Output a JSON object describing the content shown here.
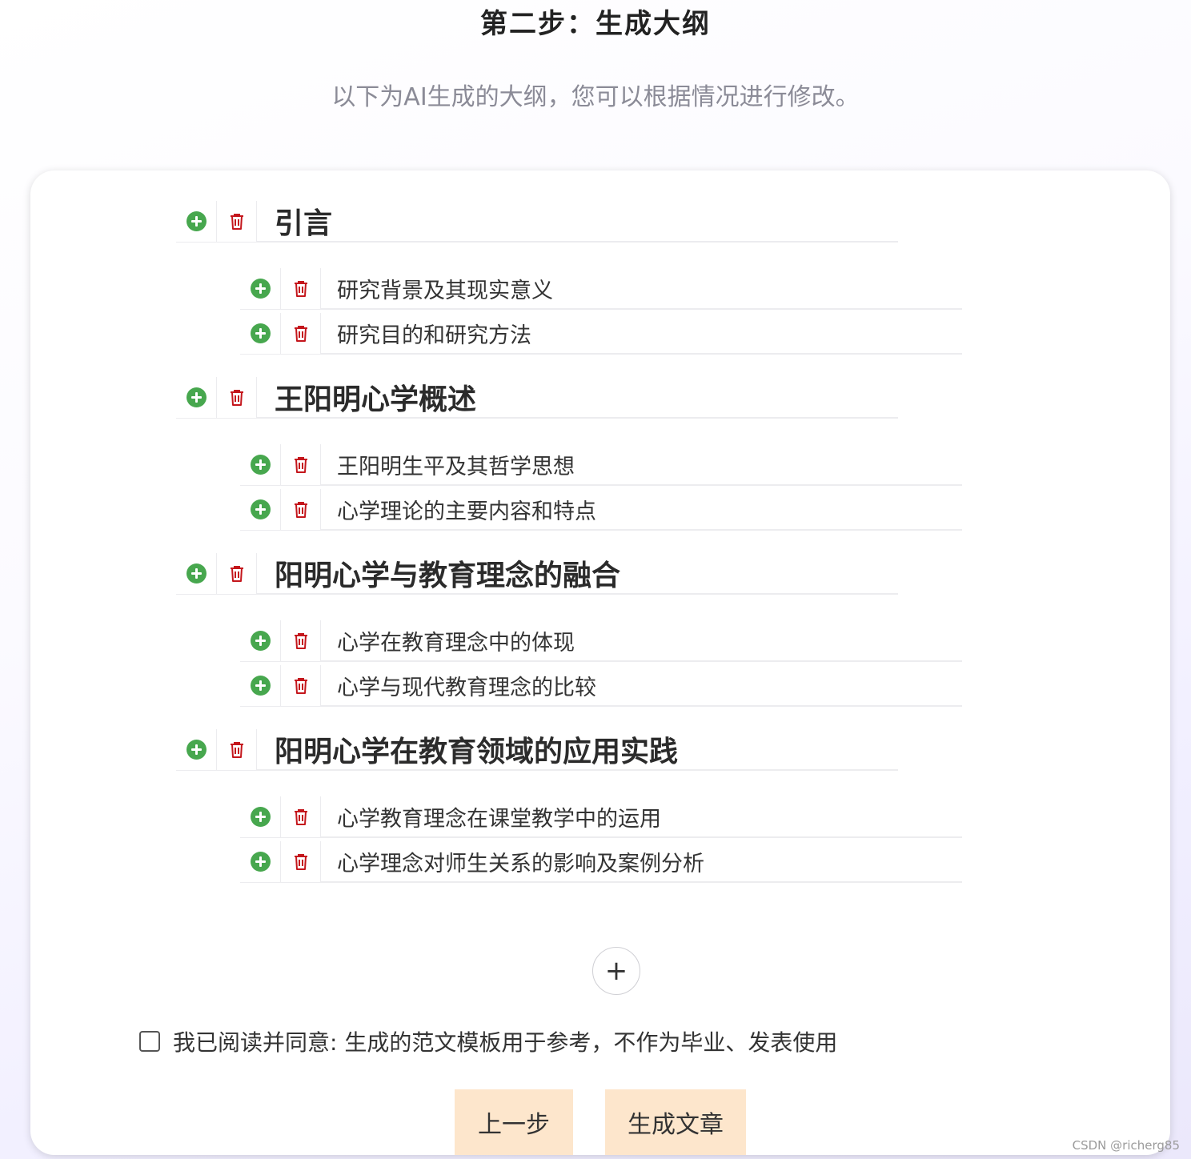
{
  "header": {
    "title": "第二步：生成大纲",
    "subtitle": "以下为AI生成的大纲，您可以根据情况进行修改。"
  },
  "outline": [
    {
      "title": "引言",
      "children": [
        "研究背景及其现实意义",
        "研究目的和研究方法"
      ]
    },
    {
      "title": "王阳明心学概述",
      "children": [
        "王阳明生平及其哲学思想",
        "心学理论的主要内容和特点"
      ]
    },
    {
      "title": "阳明心学与教育理念的融合",
      "children": [
        "心学在教育理念中的体现",
        "心学与现代教育理念的比较"
      ]
    },
    {
      "title": "阳明心学在教育领域的应用实践",
      "children": [
        "心学教育理念在课堂教学中的运用",
        "心学理念对师生关系的影响及案例分析"
      ]
    }
  ],
  "icons": {
    "add": "plus-circle-icon",
    "delete": "trash-icon",
    "add_section": "+"
  },
  "colors": {
    "add_icon": "#47a74e",
    "delete_icon": "#c4161c",
    "button_bg": "#fde6cc"
  },
  "agreement": {
    "checked": false,
    "label": "我已阅读并同意: 生成的范文模板用于参考，不作为毕业、发表使用"
  },
  "buttons": {
    "prev": "上一步",
    "generate": "生成文章"
  },
  "watermark": "CSDN @richerg85"
}
